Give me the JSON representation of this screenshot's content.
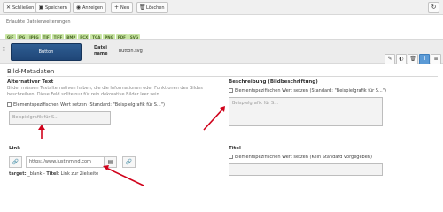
{
  "toolbar": {
    "close_label": "Schließen",
    "save_label": "Speichern",
    "view_label": "Anzeigen",
    "new_label": "Neu",
    "delete_label": "Löschen"
  },
  "allowed_caption": "Erlaubte Dateierweiterungen",
  "extensions": [
    "GIF",
    "JPG",
    "JPEG",
    "TIF",
    "TIFF",
    "BMP",
    "PCX",
    "TGA",
    "PNG",
    "PDF",
    "SVG"
  ],
  "file": {
    "thumb_text": "Button",
    "label": "Datei name",
    "name": "button.svg"
  },
  "section_title": "Bild-Metadaten",
  "alt": {
    "label": "Alternativer Text",
    "description": "Bilder müssen Textalternativen haben, die die Informationen oder Funktionen des Bildes beschreiben. Diese Feld sollte nur für rein dekorative Bilder leer sein.",
    "checkbox": "Elementspezifischen Wert setzen (Standard: \"Beispielgrafik für S...\")",
    "placeholder": "Beispielgrafik für S..."
  },
  "caption_field": {
    "label": "Beschreibung (Bildbeschriftung)",
    "checkbox": "Elementspezifischen Wert setzen (Standard: \"Beispielgrafik für S...\")",
    "placeholder": "Beispielgrafik für S..."
  },
  "link": {
    "label": "Link",
    "value": "https://www.justinmind.com",
    "target_key": "target:",
    "target_value": "_blank",
    "title_key": "Titel:",
    "title_value": "Link zur Zielseite"
  },
  "title_field": {
    "label": "Titel",
    "checkbox": "Elementspezifischen Wert setzen (Kein Standard vorgegeben)"
  },
  "colors": {
    "arrow": "#d0021b",
    "ext_badge": "#c9e6a5",
    "thumb": "#2f5e93"
  }
}
